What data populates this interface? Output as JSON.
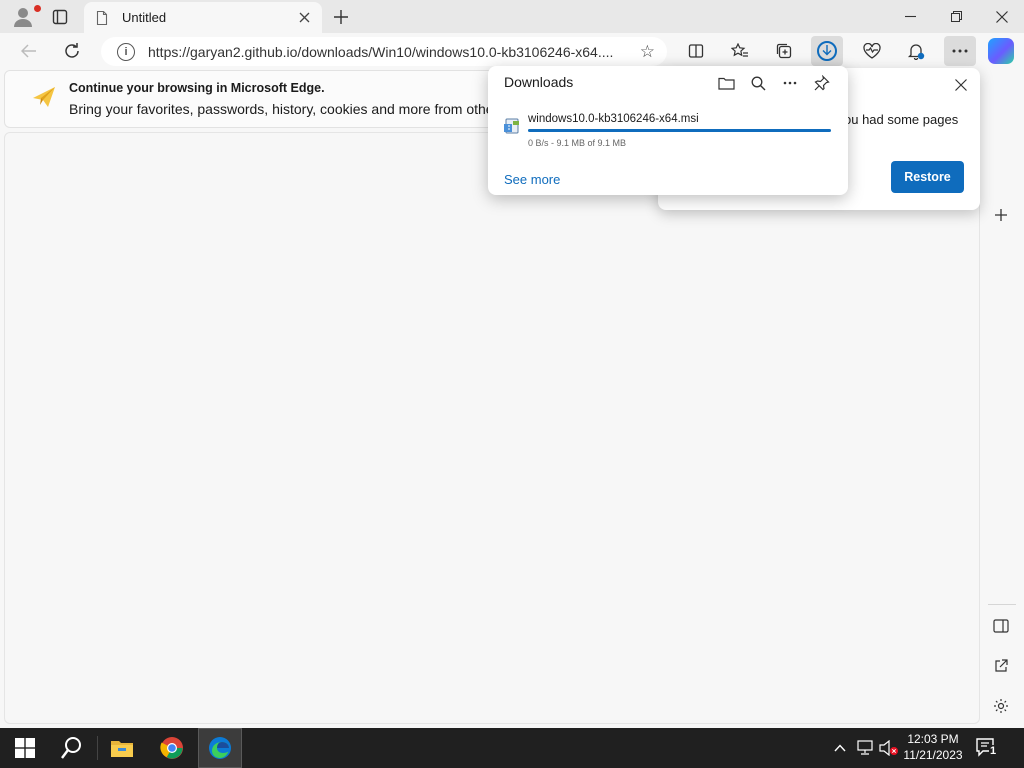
{
  "browser": {
    "tab_title": "Untitled",
    "url": "https://garyan2.github.io/downloads/Win10/windows10.0-kb3106246-x64...."
  },
  "infobar": {
    "heading": "Continue your browsing in Microsoft Edge.",
    "body": "Bring your favorites, passwords, history, cookies and more from other"
  },
  "restore_popup": {
    "text": "ou had some pages",
    "button_label": "Restore"
  },
  "downloads": {
    "title": "Downloads",
    "items": [
      {
        "filename": "windows10.0-kb3106246-x64.msi",
        "status": "0 B/s - 9.1 MB of 9.1 MB",
        "progress": 1.0
      }
    ],
    "see_more_label": "See more"
  },
  "taskbar": {
    "time": "12:03 PM",
    "date": "11/21/2023",
    "notification_count": "1"
  },
  "colors": {
    "accent": "#0f6cbd",
    "taskbar": "#202020"
  }
}
